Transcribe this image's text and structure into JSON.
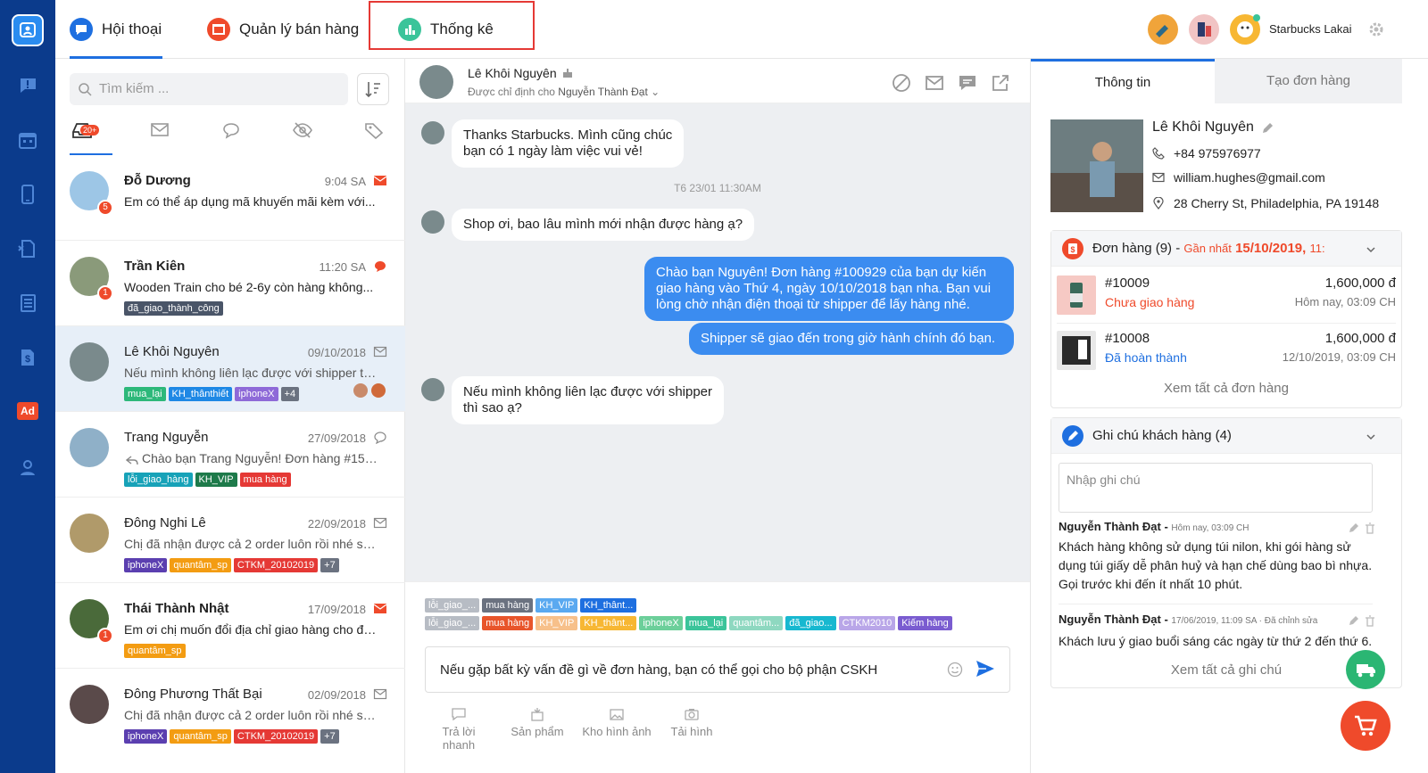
{
  "topbar": {
    "tabs": [
      {
        "label": "Hội thoại",
        "icon": "chat-bubble-icon"
      },
      {
        "label": "Quản lý bán hàng",
        "icon": "store-icon"
      },
      {
        "label": "Thống kê",
        "icon": "bar-chart-icon"
      }
    ],
    "user_name": "Starbucks Lakai"
  },
  "sidebar": {
    "ad_label": "Ad"
  },
  "conversations": {
    "search_placeholder": "Tìm kiếm ...",
    "inbox_badge": "20+",
    "items": [
      {
        "name": "Đỗ Dương",
        "time": "9:04 SA",
        "message": "Em có thể áp dụng mã khuyến mãi kèm với...",
        "unread": "5",
        "status": "email-unread",
        "tags": []
      },
      {
        "name": "Trần Kiên",
        "time": "11:20 SA",
        "message": "Wooden Train cho bé 2-6y còn hàng không...",
        "unread": "1",
        "status": "chat-unread",
        "tags": [
          "đã_giao_thành_công"
        ]
      },
      {
        "name": "Lê Khôi Nguyên",
        "time": "09/10/2018",
        "message": "Nếu mình không liên lạc được với shipper thì...",
        "status": "email-read",
        "tags": [
          "mua_lại",
          "KH_thânthiết",
          "iphoneX",
          "+4"
        ]
      },
      {
        "name": "Trang Nguyễn",
        "time": "27/09/2018",
        "message": "Chào bạn Trang Nguyễn! Đơn hàng #152...",
        "status": "chat-read",
        "tags": [
          "lỗi_giao_hàng",
          "KH_VIP",
          "mua hàng"
        ]
      },
      {
        "name": "Đông Nghi Lê",
        "time": "22/09/2018",
        "message": "Chị đã nhận được cả 2 order luôn rồi nhé sh...",
        "status": "email-read",
        "tags": [
          "iphoneX",
          "quantâm_sp",
          "CTKM_20102019",
          "+7"
        ]
      },
      {
        "name": "Thái Thành Nhật",
        "time": "17/09/2018",
        "message": "Em ơi chị muốn đổi địa chỉ giao hàng cho đơ...",
        "unread": "1",
        "status": "email-unread",
        "tags": [
          "quantâm_sp"
        ]
      },
      {
        "name": "Đông Phương Thất Bại",
        "time": "02/09/2018",
        "message": "Chị đã nhận được cả 2 order luôn rồi nhé sh...",
        "status": "email-read",
        "tags": [
          "iphoneX",
          "quantâm_sp",
          "CTKM_20102019",
          "+7"
        ]
      }
    ]
  },
  "chat": {
    "contact_name": "Lê Khôi Nguyên",
    "assigned_prefix": "Được chỉ định cho",
    "assigned_to": "Nguyễn Thành Đạt",
    "messages": [
      {
        "dir": "in",
        "text1": "Thanks Starbucks. Mình cũng chúc",
        "text2": "bạn có 1 ngày làm việc vui vẻ!"
      },
      {
        "dir": "sep",
        "text": "T6 23/01 11:30AM"
      },
      {
        "dir": "in",
        "text1": "Shop ơi, bao lâu mình mới nhận được hàng ạ?"
      },
      {
        "dir": "out",
        "text1": "Chào bạn Nguyên! Đơn hàng #100929 của bạn dự kiến",
        "text2": "giao hàng vào Thứ 4, ngày 10/10/2018 bạn nha. Bạn vui",
        "text3": "lòng chờ nhận điện thoại từ shipper để lấy hàng nhé."
      },
      {
        "dir": "out",
        "text1": "Shipper sẽ giao đến trong giờ hành chính đó bạn."
      },
      {
        "dir": "in",
        "text1": "Nếu mình không liên lạc được với shipper",
        "text2": "thì sao ạ?"
      }
    ],
    "tag_row1": [
      "lỗi_giao_...",
      "mua hàng",
      "KH_VIP",
      "KH_thânt..."
    ],
    "tag_row2": [
      "lỗi_giao_...",
      "mua hàng",
      "KH_VIP",
      "KH_thânt...",
      "iphoneX",
      "mua_lại",
      "quantâm...",
      "đã_giao...",
      "CTKM2010",
      "Kiếm hàng"
    ],
    "input_value": "Nếu gặp bất kỳ vấn đề gì về đơn hàng, bạn có thể gọi cho bộ phận CSKH",
    "quick_actions": [
      "Trả lời nhanh",
      "Sản phẩm",
      "Kho hình ảnh",
      "Tải hình"
    ]
  },
  "info": {
    "tabs": [
      "Thông tin",
      "Tạo đơn hàng"
    ],
    "name": "Lê Khôi Nguyên",
    "phone": "+84 975976977",
    "email": "william.hughes@gmail.com",
    "address": "28 Cherry St, Philadelphia, PA 19148",
    "orders": {
      "title": "Đơn hàng (9) -",
      "latest_label": "Gần nhất",
      "latest_date": "15/10/2019,",
      "latest_time": "11:",
      "items": [
        {
          "id": "#10009",
          "status": "Chưa giao hàng",
          "price": "1,600,000 đ",
          "date": "Hôm nay, 03:09 CH"
        },
        {
          "id": "#10008",
          "status": "Đã hoàn thành",
          "price": "1,600,000 đ",
          "date": "12/10/2019, 03:09 CH"
        }
      ],
      "see_all": "Xem tất cả đơn hàng"
    },
    "notes": {
      "title": "Ghi chú khách hàng (4)",
      "placeholder": "Nhập ghi chú",
      "items": [
        {
          "author": "Nguyễn Thành Đạt -",
          "meta": "Hôm nay, 03:09 CH",
          "line1": "Khách hàng không sử dụng túi nilon, khi gói hàng sử",
          "line2": "dụng túi giấy dễ phân huỷ và hạn chế dùng bao bì nhựa.",
          "line3": "Gọi trước khi đến ít nhất 10 phút."
        },
        {
          "author": "Nguyễn Thành Đạt -",
          "meta": "17/06/2019, 11:09 SA · Đã chỉnh sửa",
          "line1": "Khách lưu ý giao buổi sáng các ngày từ thứ 2 đến thứ 6."
        }
      ],
      "see_all": "Xem tất cả ghi chú"
    }
  },
  "colors": {
    "primary": "#1e6fe0",
    "sidebar": "#0b3b8c",
    "accent": "#ef4a2b",
    "outgoing_bubble": "#3b8cf0"
  }
}
